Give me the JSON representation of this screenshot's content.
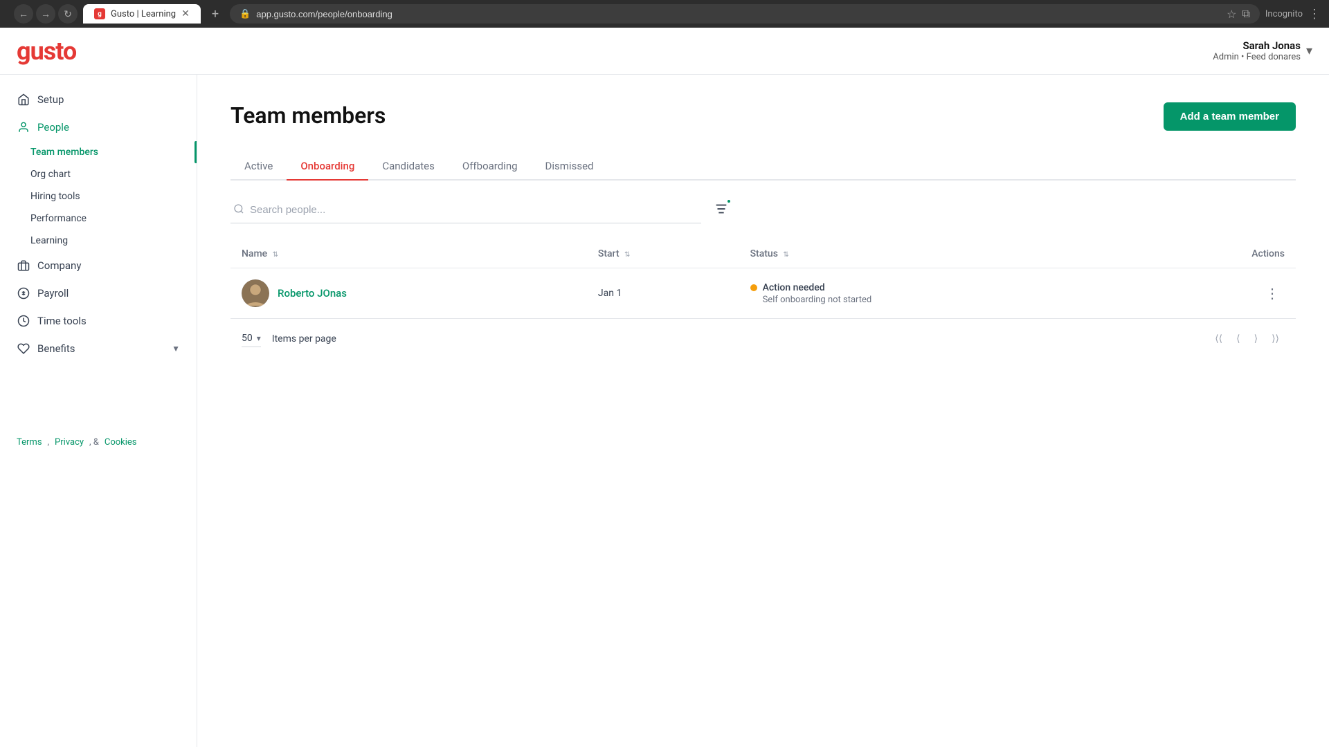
{
  "browser": {
    "tab_title": "Gusto | Learning",
    "tab_favicon": "g",
    "url": "app.gusto.com/people/onboarding",
    "incognito_label": "Incognito"
  },
  "header": {
    "logo": "gusto",
    "user_name": "Sarah Jonas",
    "user_role": "Admin • Feed donares",
    "chevron": "▾"
  },
  "sidebar": {
    "items": [
      {
        "id": "setup",
        "label": "Setup",
        "icon": "home"
      },
      {
        "id": "people",
        "label": "People",
        "icon": "person",
        "active": true,
        "subitems": [
          {
            "id": "team-members",
            "label": "Team members",
            "active": true
          },
          {
            "id": "org-chart",
            "label": "Org chart"
          },
          {
            "id": "hiring-tools",
            "label": "Hiring tools"
          },
          {
            "id": "performance",
            "label": "Performance"
          },
          {
            "id": "learning",
            "label": "Learning"
          }
        ]
      },
      {
        "id": "company",
        "label": "Company",
        "icon": "building"
      },
      {
        "id": "payroll",
        "label": "Payroll",
        "icon": "dollar"
      },
      {
        "id": "time-tools",
        "label": "Time tools",
        "icon": "clock"
      },
      {
        "id": "benefits",
        "label": "Benefits",
        "icon": "heart"
      }
    ]
  },
  "page": {
    "title": "Team members",
    "add_button": "Add a team member"
  },
  "tabs": [
    {
      "id": "active",
      "label": "Active"
    },
    {
      "id": "onboarding",
      "label": "Onboarding",
      "active": true
    },
    {
      "id": "candidates",
      "label": "Candidates"
    },
    {
      "id": "offboarding",
      "label": "Offboarding"
    },
    {
      "id": "dismissed",
      "label": "Dismissed"
    }
  ],
  "search": {
    "placeholder": "Search people..."
  },
  "table": {
    "columns": [
      {
        "id": "name",
        "label": "Name",
        "sortable": true
      },
      {
        "id": "start",
        "label": "Start",
        "sortable": true
      },
      {
        "id": "status",
        "label": "Status",
        "sortable": true
      },
      {
        "id": "actions",
        "label": "Actions",
        "sortable": false
      }
    ],
    "rows": [
      {
        "id": 1,
        "name": "Roberto JOnas",
        "start": "Jan 1",
        "status_label": "Action needed",
        "status_sub": "Self onboarding not started",
        "status_color": "#f59e0b"
      }
    ]
  },
  "pagination": {
    "per_page": "50",
    "items_per_page_label": "Items per page"
  },
  "footer": {
    "terms": "Terms",
    "comma1": ",",
    "privacy": "Privacy",
    "separator": ", &",
    "cookies": "Cookies"
  }
}
